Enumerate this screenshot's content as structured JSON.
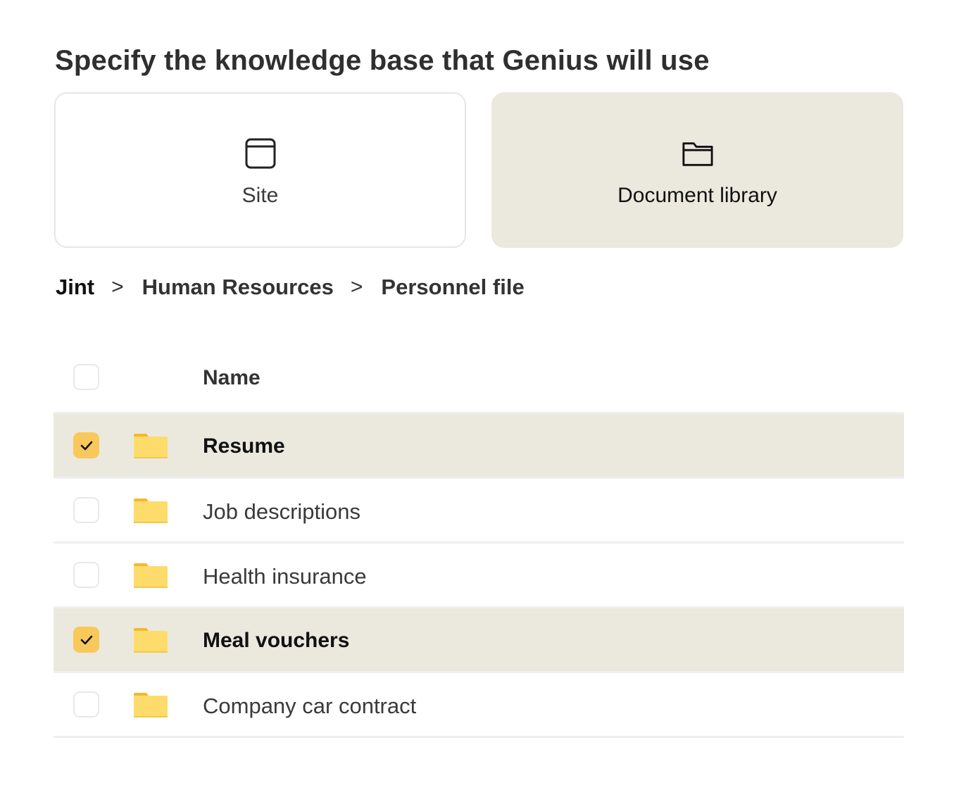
{
  "heading": "Specify the knowledge base that Genius will use",
  "cards": {
    "site": {
      "label": "Site",
      "icon": "browser-window-icon"
    },
    "library": {
      "label": "Document library",
      "icon": "folder-outline-icon",
      "selected": true
    }
  },
  "breadcrumb": {
    "items": [
      "Jint",
      "Human Resources",
      "Personnel file"
    ],
    "separator": ">"
  },
  "table": {
    "header": {
      "name": "Name"
    },
    "rows": [
      {
        "name": "Resume",
        "checked": true
      },
      {
        "name": "Job descriptions",
        "checked": false
      },
      {
        "name": "Health insurance",
        "checked": false
      },
      {
        "name": "Meal vouchers",
        "checked": true
      },
      {
        "name": "Company car contract",
        "checked": false
      }
    ]
  },
  "colors": {
    "selected_bg": "#ebe9de",
    "checkbox_checked": "#f9c85a",
    "folder_yellow": "#fddc6b",
    "folder_tab": "#f5b82e"
  }
}
